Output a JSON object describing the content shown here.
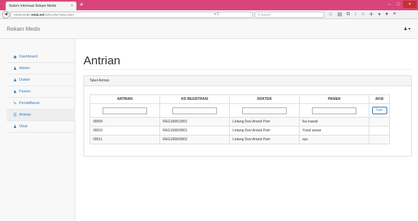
{
  "browser": {
    "tab_title": "Sistem Informasi Rekam Medis",
    "url_prefix": "rekammedis.",
    "url_domain": "netai.net",
    "url_path": "/index.php?view=antri",
    "search_placeholder": "Search"
  },
  "app": {
    "brand": "Rekam Medis",
    "user_icon": "user-icon"
  },
  "sidebar": {
    "items": [
      {
        "label": "Dashboard",
        "icon": "dashboard-icon"
      },
      {
        "label": "Admin",
        "icon": "user-icon"
      },
      {
        "label": "Dokter",
        "icon": "doctor-icon"
      },
      {
        "label": "Pasien",
        "icon": "users-icon"
      },
      {
        "label": "Pendaftaran",
        "icon": "edit-icon"
      },
      {
        "label": "Antrian",
        "icon": "list-icon"
      },
      {
        "label": "Obat",
        "icon": "medicine-icon"
      }
    ],
    "active": "Antrian"
  },
  "page": {
    "title": "Antrian",
    "panel_title": "Tabel Antrian"
  },
  "table": {
    "headers": [
      "ANTRIAN",
      "KD REGISTRASI",
      "DOKTER",
      "PASIEN",
      "AKSI"
    ],
    "search_button": "Cari",
    "rows": [
      [
        "00009",
        "REG150813001",
        "Lintang Desi Arianti Putri",
        "Ika irawati",
        ""
      ],
      [
        "00010",
        "REG150820001",
        "Lintang Desi Arianti Putri",
        "Yusuf anwar",
        ""
      ],
      [
        "00011",
        "REG150820002",
        "Lintang Desi Arianti Putri",
        "ayu",
        ""
      ]
    ]
  },
  "colors": {
    "tabbar": "#d9447a",
    "link": "#337ab7"
  }
}
